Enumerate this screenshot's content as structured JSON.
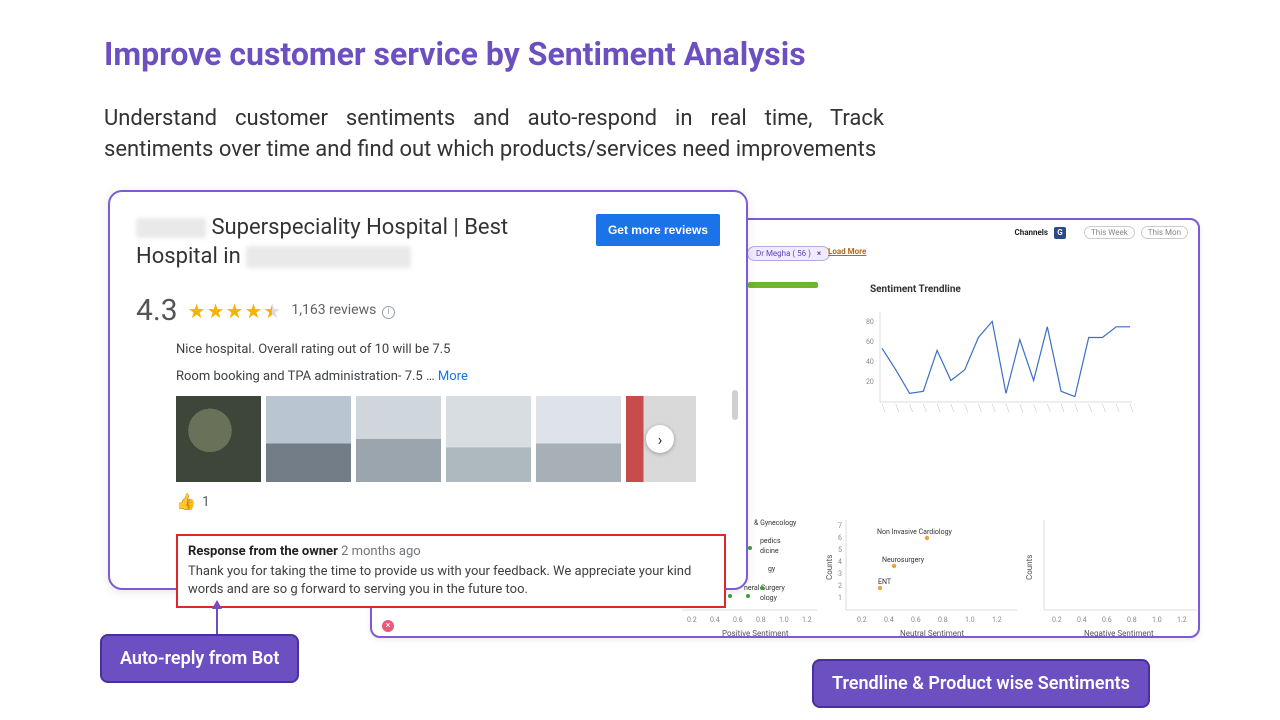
{
  "title": "Improve customer service by Sentiment Analysis",
  "subtitle": "Understand customer sentiments and auto-respond in real time, Track sentiments over time and find out which products/services need improvements",
  "callouts": {
    "left": "Auto-reply from Bot",
    "right": "Trendline & Product wise Sentiments"
  },
  "review": {
    "title_mid": "Superspeciality Hospital | Best",
    "title_line2_prefix": "Hospital in",
    "get_reviews_btn": "Get more reviews",
    "rating": "4.3",
    "review_count": "1,163 reviews",
    "body_line1": "Nice hospital. Overall rating out of 10 will be 7.5",
    "body_line2_prefix": "Room booking and TPA administration- 7.5 … ",
    "more": "More",
    "like_count": "1",
    "owner_head_bold": "Response from the owner",
    "owner_head_ago": "2 months ago",
    "owner_body": "Thank you for taking the time to provide us with your feedback. We appreciate your kind words and are so g forward to serving you in the future too."
  },
  "dashboard": {
    "channels_label": "Channels",
    "g_badge": "G",
    "periods": {
      "a": "This Week",
      "b": "This Mon"
    },
    "filter_pill": "Dr Megha ( 56 )",
    "filter_x": "×",
    "load_more": "Load More",
    "trend_title": "Sentiment Trendline",
    "left_labels": {
      "a": "& Gynecology",
      "b": "pedics",
      "c": "dicine",
      "d": "gy",
      "e": "neral Surgery",
      "f": "ology"
    },
    "scatter": {
      "pos_x_label": "Positive Sentiment",
      "neu_x_label": "Neutral Sentiment",
      "neg_x_label": "Negative Sentiment",
      "y_label": "Counts",
      "y_ticks": [
        "1",
        "2",
        "3",
        "4",
        "5",
        "6",
        "7"
      ],
      "x_ticks": [
        "0.2",
        "0.4",
        "0.6",
        "0.8",
        "1.0",
        "1.2"
      ],
      "neutral_labels": {
        "a": "Non Invasive Cardiology",
        "b": "Neurosurgery",
        "c": "ENT"
      }
    }
  },
  "chart_data": {
    "type": "line",
    "title": "Sentiment Trendline",
    "ylabel": "",
    "xlabel": "",
    "ylim": [
      0,
      80
    ],
    "y_ticks": [
      20,
      40,
      60,
      80
    ],
    "values": [
      50,
      30,
      8,
      10,
      48,
      20,
      30,
      60,
      75,
      8,
      58,
      20,
      70,
      10,
      5,
      60,
      60,
      70,
      70
    ]
  }
}
